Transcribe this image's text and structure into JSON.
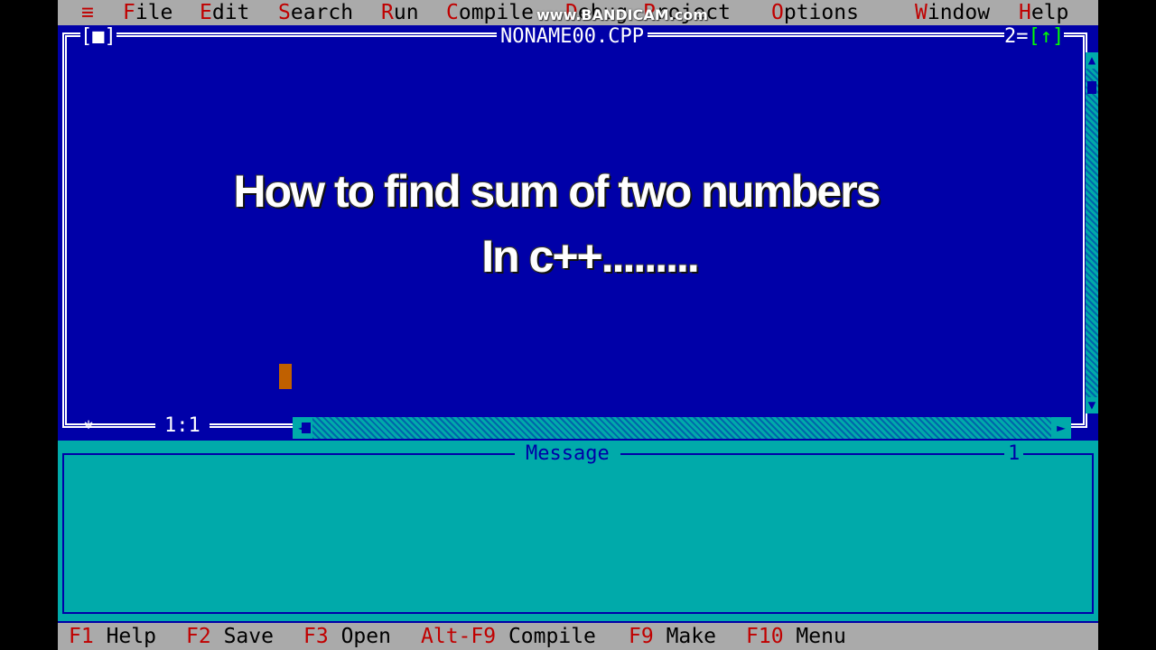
{
  "menubar": {
    "system_icon": "≡",
    "items": [
      {
        "hot": "F",
        "rest": "ile"
      },
      {
        "hot": "E",
        "rest": "dit"
      },
      {
        "hot": "S",
        "rest": "earch"
      },
      {
        "hot": "R",
        "rest": "un"
      },
      {
        "hot": "C",
        "rest": "ompile"
      },
      {
        "hot": "D",
        "rest": "ebug"
      },
      {
        "hot": "P",
        "rest": "roject"
      },
      {
        "hot": "O",
        "rest": "ptions"
      },
      {
        "hot": "W",
        "rest": "indow"
      },
      {
        "hot": "H",
        "rest": "elp"
      }
    ]
  },
  "watermark": "www.BANDICAM.com",
  "editor": {
    "close_box": "[■]",
    "title": "NONAME00.CPP",
    "window_number": "2",
    "zoom_box": "[↑]",
    "cursor_position": "1:1"
  },
  "caption": {
    "line1": "How to find sum of two numbers",
    "line2": "In c++........."
  },
  "message_window": {
    "title": "Message",
    "number": "1"
  },
  "statusbar": {
    "items": [
      {
        "key": "F1",
        "label": "Help"
      },
      {
        "key": "F2",
        "label": "Save"
      },
      {
        "key": "F3",
        "label": "Open"
      },
      {
        "key": "Alt-F9",
        "label": "Compile"
      },
      {
        "key": "F9",
        "label": "Make"
      },
      {
        "key": "F10",
        "label": "Menu"
      }
    ]
  },
  "colors": {
    "editor_bg": "#0000a8",
    "menubar_bg": "#aaaaaa",
    "hotkey": "#c00000",
    "message_bg": "#00aaaa",
    "cursor": "#c06000"
  }
}
